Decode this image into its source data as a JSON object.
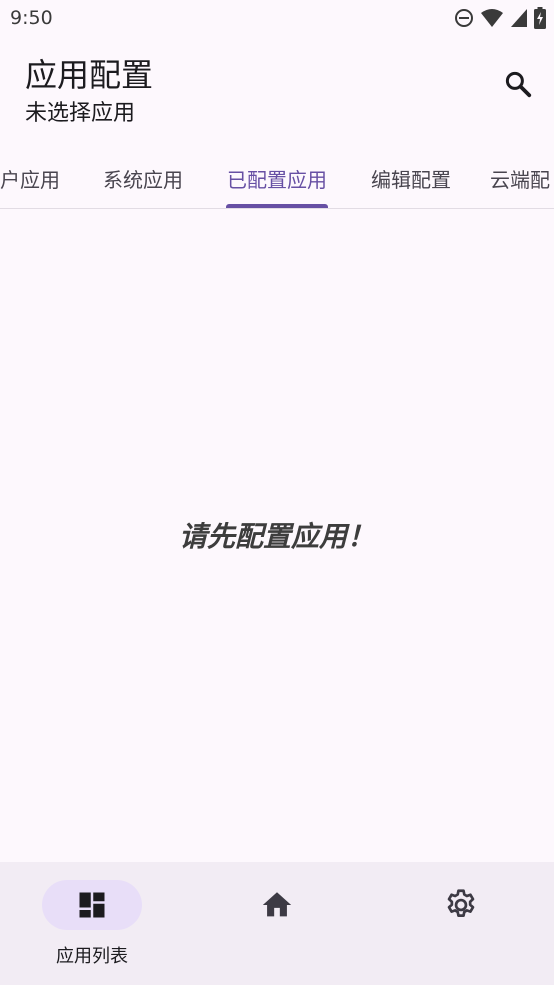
{
  "status_bar": {
    "time": "9:50",
    "icons": [
      "do-not-disturb-icon",
      "wifi-icon",
      "signal-icon",
      "battery-charging-icon"
    ]
  },
  "app_bar": {
    "title": "应用配置",
    "subtitle": "未选择应用",
    "search_icon": "search-icon"
  },
  "tabs": [
    {
      "label": "户应用",
      "active": false
    },
    {
      "label": "系统应用",
      "active": false
    },
    {
      "label": "已配置应用",
      "active": true
    },
    {
      "label": "编辑配置",
      "active": false
    },
    {
      "label": "云端配",
      "active": false
    }
  ],
  "main": {
    "empty_message": "请先配置应用！"
  },
  "bottom_nav": {
    "items": [
      {
        "label": "应用列表",
        "icon": "dashboard-icon",
        "active": true
      },
      {
        "label": "",
        "icon": "home-icon",
        "active": false
      },
      {
        "label": "",
        "icon": "settings-icon",
        "active": false
      }
    ]
  },
  "colors": {
    "background": "#fdf8fd",
    "accent": "#6750a4",
    "nav_background": "#f2ecf4",
    "nav_active_pill": "#e8def8"
  }
}
